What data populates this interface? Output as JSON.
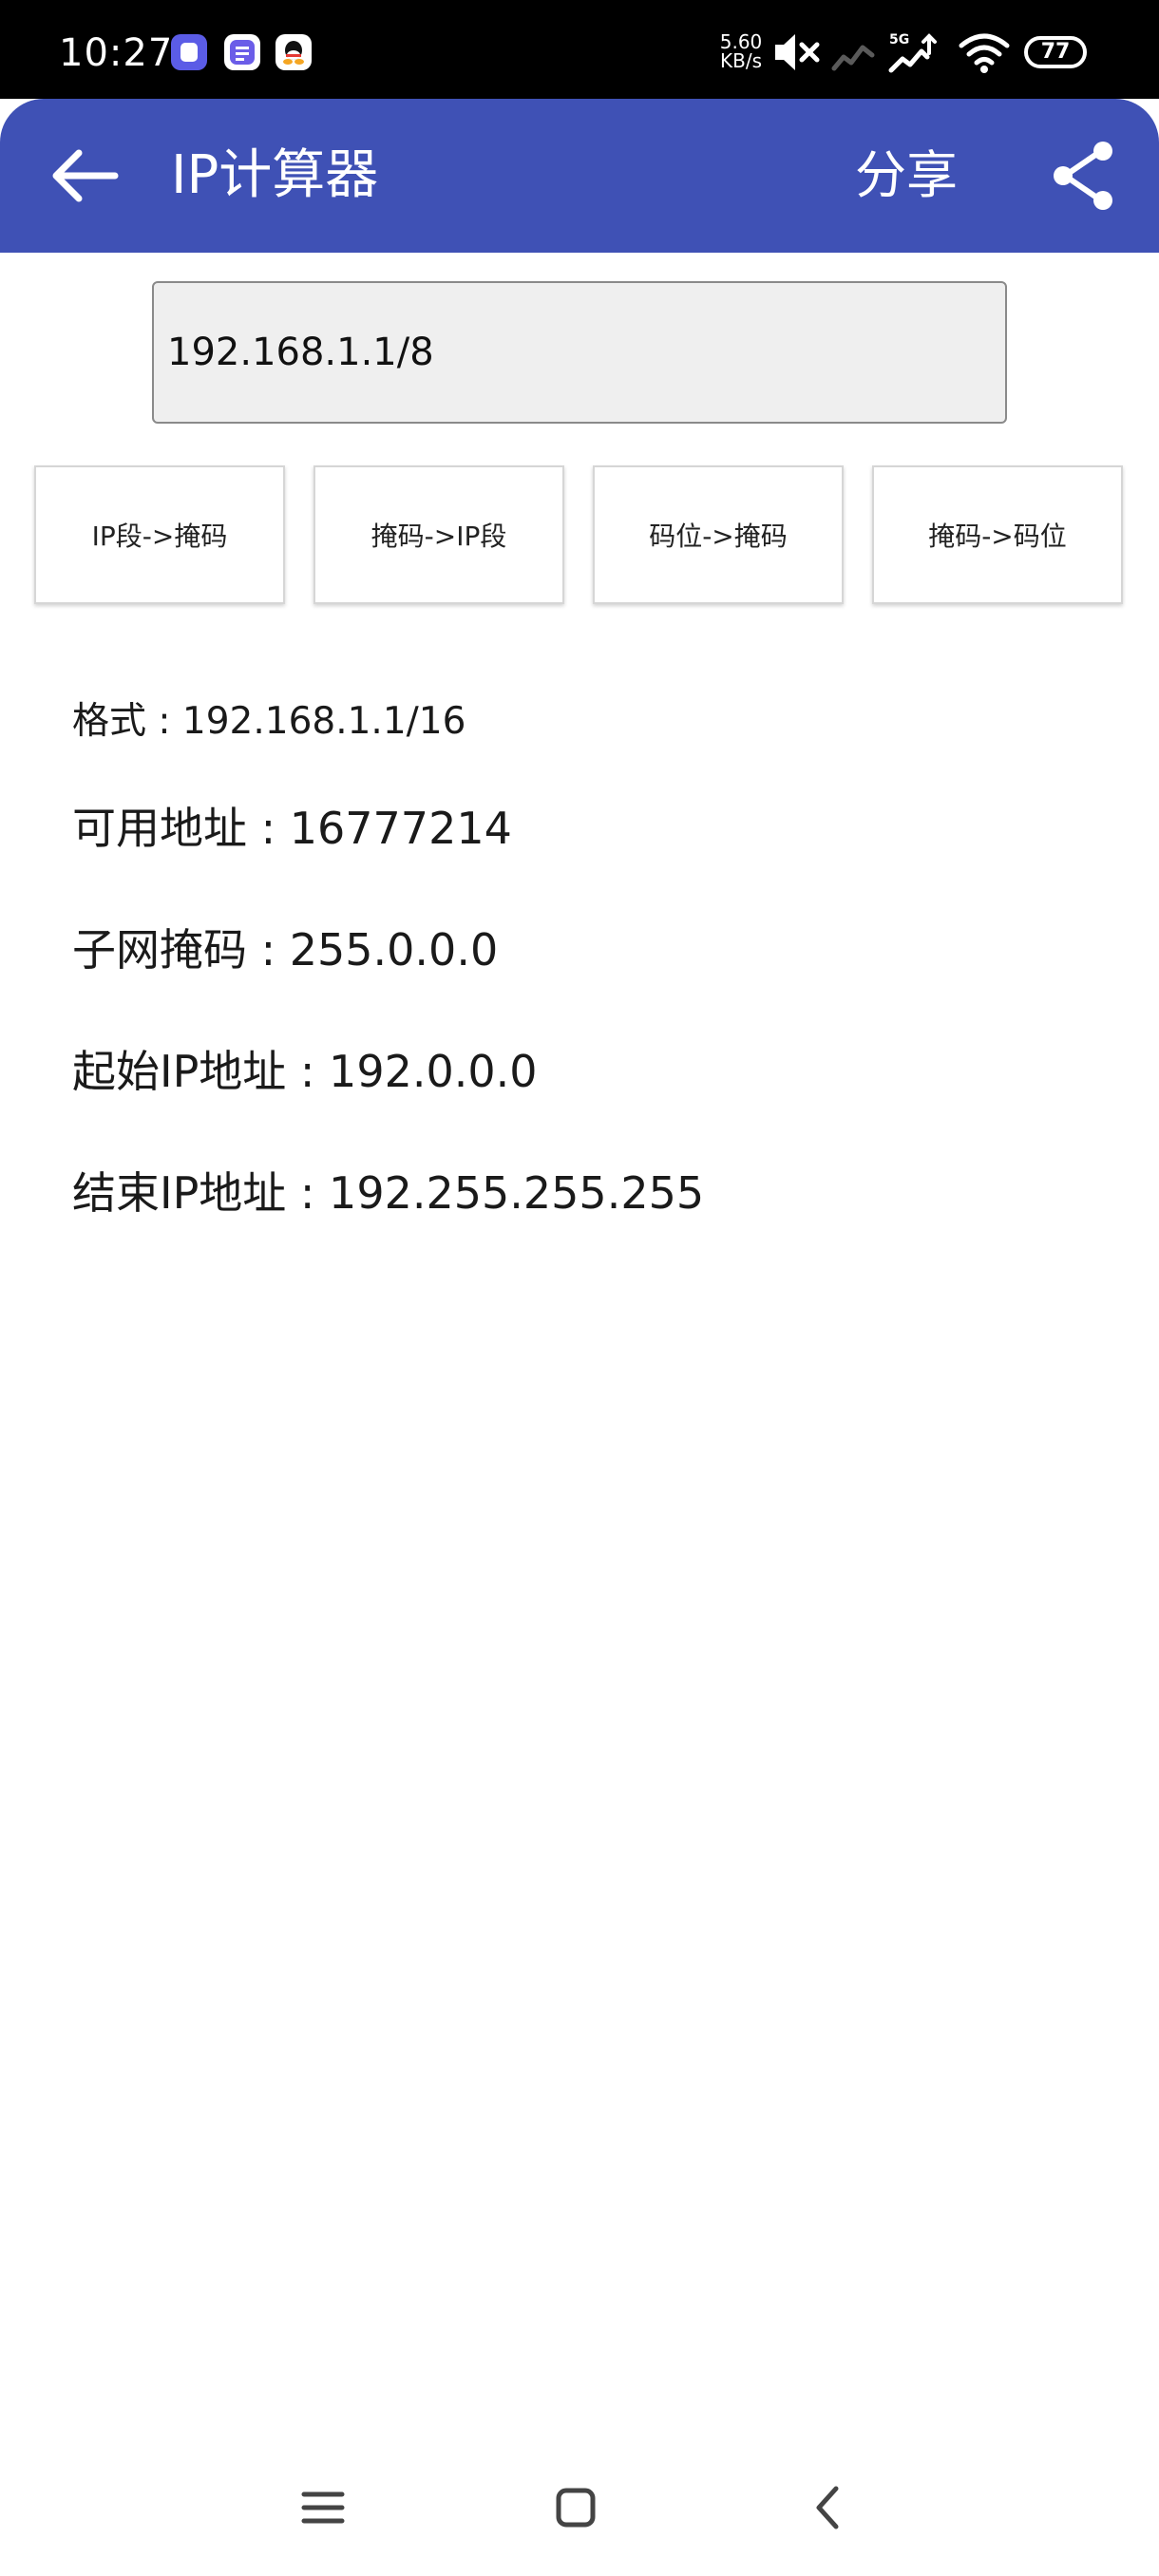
{
  "status_bar": {
    "time": "10:27",
    "net_speed_value": "5.60",
    "net_speed_unit": "KB/s",
    "network_label": "5G",
    "battery_level": "77",
    "notification_icons": [
      "app-notification-icon",
      "tiezhi-notification-icon",
      "qq-notification-icon"
    ],
    "icons": [
      "mute-icon",
      "signal-icon",
      "signal-5g-icon",
      "wifi-icon",
      "battery-icon"
    ]
  },
  "app_bar": {
    "title": "IP计算器",
    "share_label": "分享",
    "color": "#3f51b5"
  },
  "input": {
    "value": "192.168.1.1/8"
  },
  "actions": [
    {
      "label": "IP段->掩码"
    },
    {
      "label": "掩码->IP段"
    },
    {
      "label": "码位->掩码"
    },
    {
      "label": "掩码->码位"
    }
  ],
  "results": {
    "format": "格式 : 192.168.1.1/16",
    "usable": "可用地址 : 16777214",
    "mask": "子网掩码 : 255.0.0.0",
    "start_ip": "起始IP地址 : 192.0.0.0",
    "end_ip": "结束IP地址 : 192.255.255.255"
  },
  "nav": {
    "icons": [
      "menu-icon",
      "home-icon",
      "back-icon"
    ]
  }
}
